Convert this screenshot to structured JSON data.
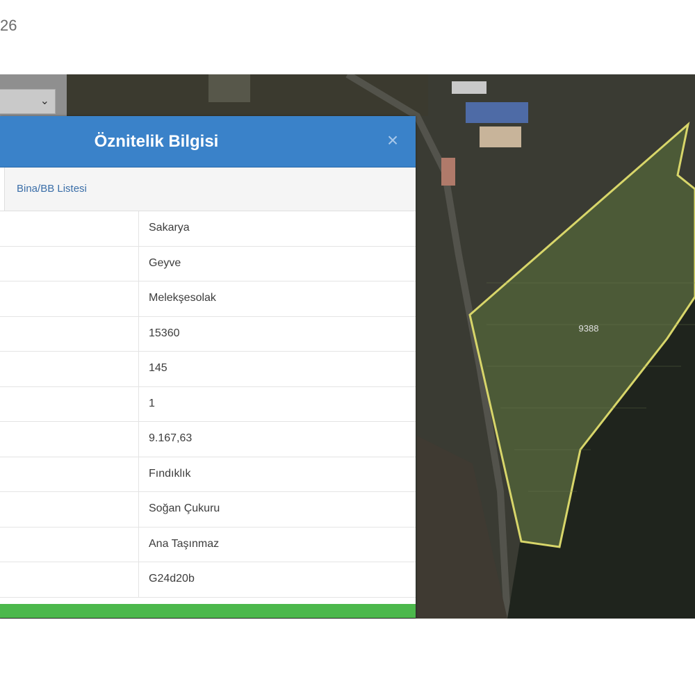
{
  "page": {
    "top_number": "26"
  },
  "dialog": {
    "title": "Öznitelik Bilgisi",
    "close_symbol": "×",
    "tab_label": "Bina/BB Listesi",
    "rows": [
      {
        "value": "Sakarya"
      },
      {
        "value": "Geyve"
      },
      {
        "value": "Melekşesolak"
      },
      {
        "value": "15360"
      },
      {
        "value": "145"
      },
      {
        "value": "1"
      },
      {
        "value": "9.167,63"
      },
      {
        "value": "Fındıklık"
      },
      {
        "value": "Soğan Çukuru"
      },
      {
        "value": "Ana Taşınmaz"
      },
      {
        "value": "G24d20b"
      }
    ]
  },
  "map": {
    "parcel_label": "9388",
    "parcel_outline_color": "#d8d66a",
    "header_color": "#3a82c9",
    "footer_color": "#4cb84c"
  },
  "icons": {
    "select_chevron": "chevron-down-icon",
    "close": "close-icon"
  }
}
